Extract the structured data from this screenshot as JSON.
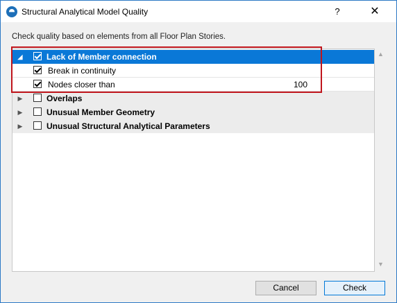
{
  "window": {
    "title": "Structural Analytical Model Quality",
    "help_label": "?",
    "close_label": "✕"
  },
  "description": "Check quality based on elements from all Floor Plan Stories.",
  "tree": {
    "items": [
      {
        "label": "Lack of Member connection",
        "checked": true,
        "expanded": true,
        "selected": true
      },
      {
        "label": "Break in continuity",
        "checked": true
      },
      {
        "label": "Nodes closer than",
        "checked": true,
        "value": "100"
      },
      {
        "label": "Overlaps",
        "checked": false,
        "expanded": false
      },
      {
        "label": "Unusual Member Geometry",
        "checked": false,
        "expanded": false
      },
      {
        "label": "Unusual Structural Analytical Parameters",
        "checked": false,
        "expanded": false
      }
    ]
  },
  "buttons": {
    "cancel": "Cancel",
    "check": "Check"
  },
  "colors": {
    "selection": "#0a78d7",
    "highlight_border": "#c0151c",
    "window_border": "#2b78c5"
  }
}
